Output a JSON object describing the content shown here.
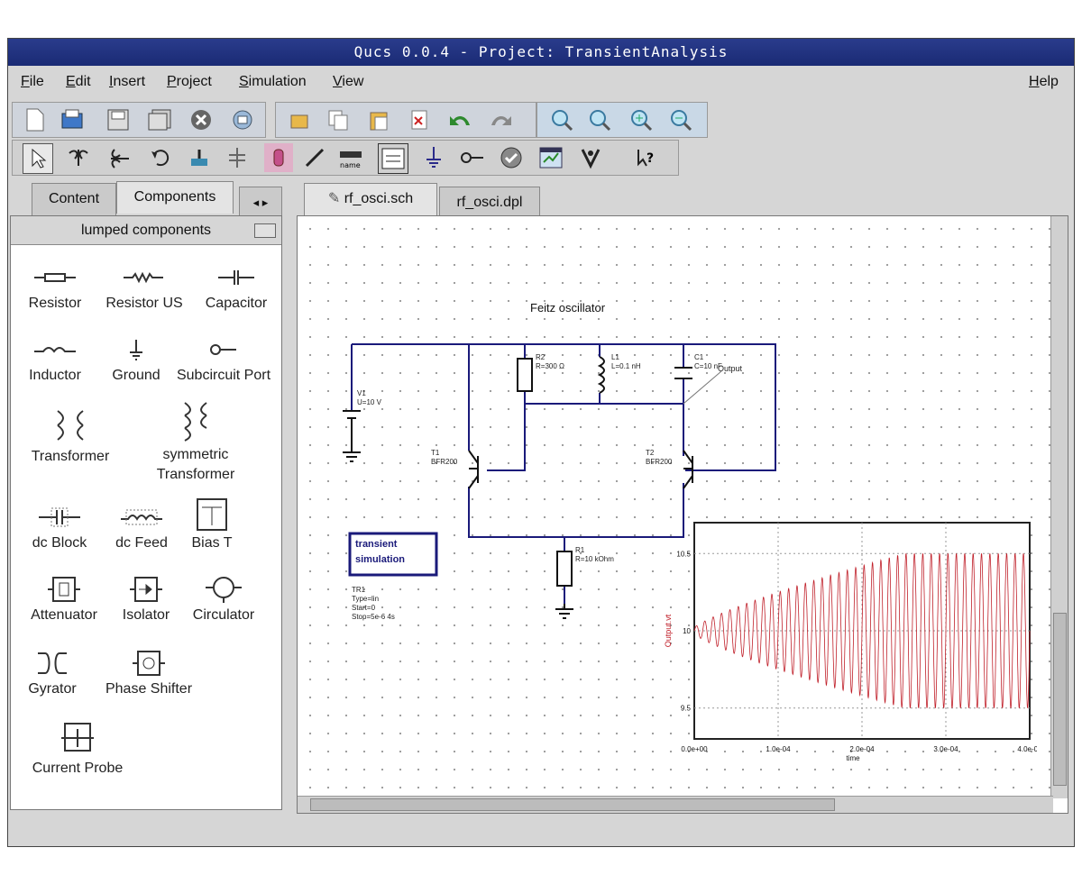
{
  "window": {
    "title": "Qucs 0.0.4 - Project: TransientAnalysis"
  },
  "menu": {
    "file": "File",
    "edit": "Edit",
    "insert": "Insert",
    "project": "Project",
    "simulation": "Simulation",
    "view": "View",
    "help": "Help"
  },
  "left_tabs": {
    "content": "Content",
    "components": "Components"
  },
  "doc_tabs": {
    "schematic": "rf_osci.sch",
    "display": "rf_osci.dpl"
  },
  "component_group": "lumped components",
  "components": [
    {
      "label": "Resistor",
      "icon": "resistor-icon"
    },
    {
      "label": "Resistor US",
      "icon": "resistor-us-icon"
    },
    {
      "label": "Capacitor",
      "icon": "capacitor-icon"
    },
    {
      "label": "Inductor",
      "icon": "inductor-icon"
    },
    {
      "label": "Ground",
      "icon": "ground-icon"
    },
    {
      "label": "Subcircuit Port",
      "icon": "subcircuit-port-icon"
    },
    {
      "label": "Transformer",
      "icon": "transformer-icon"
    },
    {
      "label": "symmetric Transformer",
      "icon": "symmetric-transformer-icon"
    },
    {
      "label": "dc Block",
      "icon": "dc-block-icon"
    },
    {
      "label": "dc Feed",
      "icon": "dc-feed-icon"
    },
    {
      "label": "Bias T",
      "icon": "bias-t-icon"
    },
    {
      "label": "Attenuator",
      "icon": "attenuator-icon"
    },
    {
      "label": "Isolator",
      "icon": "isolator-icon"
    },
    {
      "label": "Circulator",
      "icon": "circulator-icon"
    },
    {
      "label": "Gyrator",
      "icon": "gyrator-icon"
    },
    {
      "label": "Phase Shifter",
      "icon": "phase-shifter-icon"
    },
    {
      "label": "Current Probe",
      "icon": "current-probe-icon"
    }
  ],
  "schematic": {
    "title": "Feitz oscillator",
    "sim_box_line1": "transient",
    "sim_box_line2": "simulation",
    "sim_params": [
      "TR1",
      "Type=lin",
      "Start=0",
      "Stop=5e-6 4s"
    ],
    "source_label": [
      "V1",
      "U=10 V"
    ],
    "r_top_label": [
      "R2",
      "R=300 Ω"
    ],
    "l_label": [
      "L1",
      "L=0.1 nH"
    ],
    "c_label": [
      "C1",
      "C=10 nF"
    ],
    "t1_label": [
      "T1",
      "BFR200"
    ],
    "t2_label": [
      "T2",
      "BFR200"
    ],
    "r_bot_label": [
      "R1",
      "R=10 kOhm"
    ],
    "node_label": "Output"
  },
  "chart_data": {
    "type": "line",
    "title": "",
    "xlabel": "time",
    "ylabel": "Output.vt",
    "x_ticks": [
      "0.0e+00",
      "1.0e-04",
      "2.0e-04",
      "3.0e-04",
      "4.0e-04"
    ],
    "y_ticks": [
      "10.5",
      "10",
      "9.5"
    ],
    "xlim": [
      0,
      0.0004
    ],
    "ylim": [
      9.3,
      10.7
    ],
    "grid": true,
    "series": [
      {
        "color": "#c0202a",
        "description_values": {
          "center": 10.0,
          "envelope_start": 0.02,
          "envelope_end": 0.5,
          "cycles": 40
        }
      }
    ]
  },
  "colors": {
    "titlebar": "#1f3080",
    "wire": "#1a1a7a",
    "trace": "#c0202a",
    "grid_dot": "#9a9a9a"
  }
}
